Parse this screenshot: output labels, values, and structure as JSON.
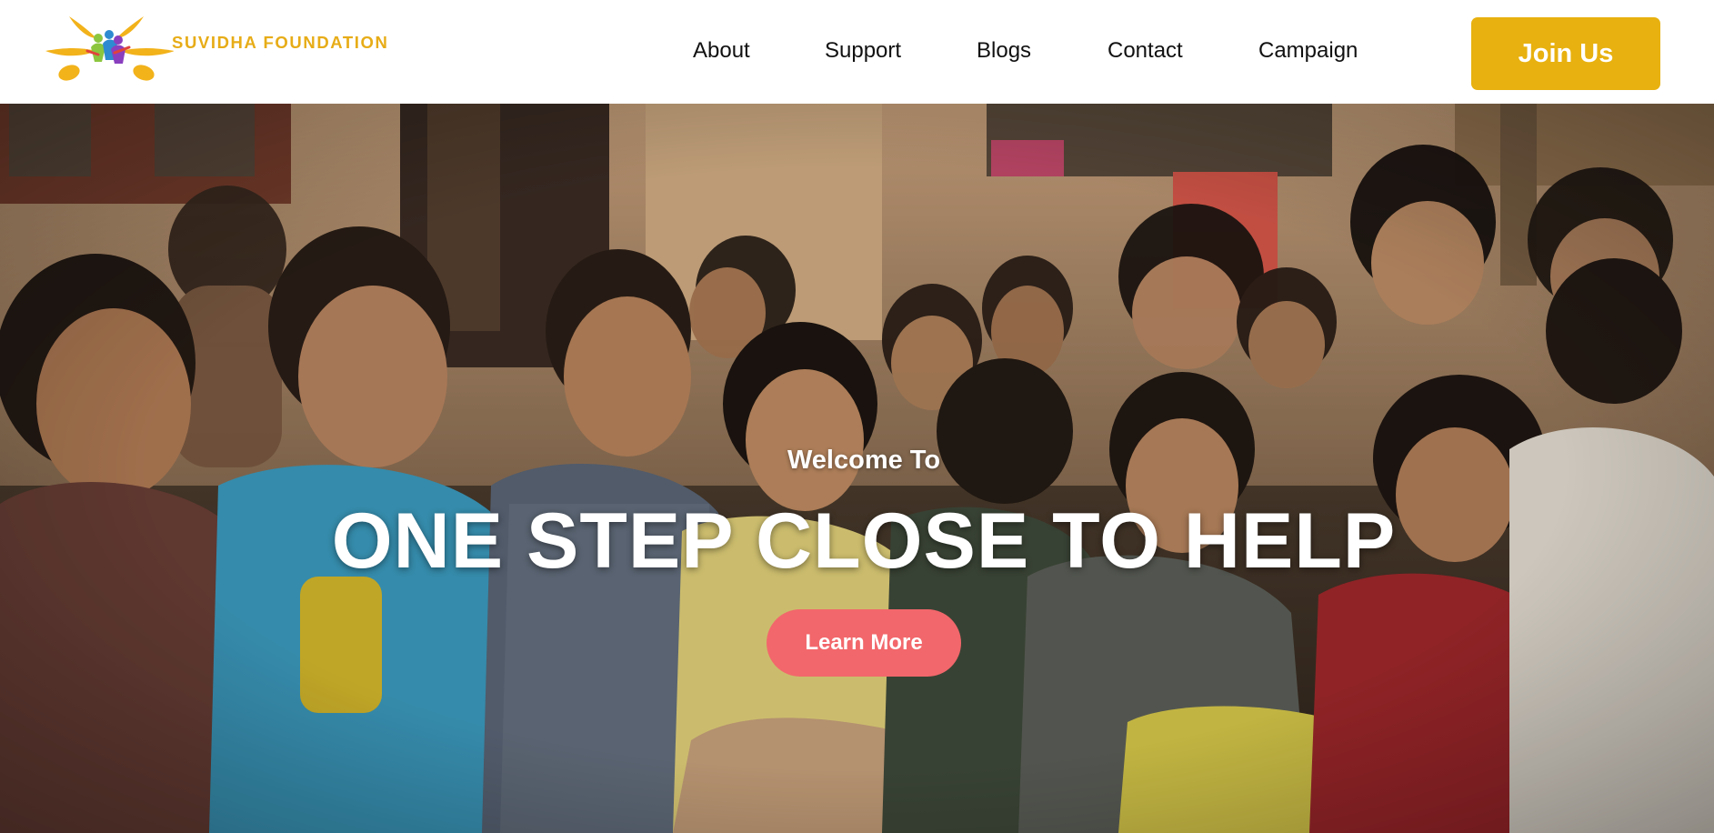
{
  "brand": {
    "name": "SUVIDHA FOUNDATION",
    "colors": {
      "accent": "#e8b10f",
      "cta": "#f2676b"
    }
  },
  "nav": {
    "items": [
      {
        "label": "About"
      },
      {
        "label": "Support"
      },
      {
        "label": "Blogs"
      },
      {
        "label": "Contact"
      },
      {
        "label": "Campaign"
      }
    ],
    "join_label": "Join Us"
  },
  "hero": {
    "subtitle": "Welcome To",
    "title": "ONE STEP CLOSE TO HELP",
    "button_label": "Learn More"
  }
}
